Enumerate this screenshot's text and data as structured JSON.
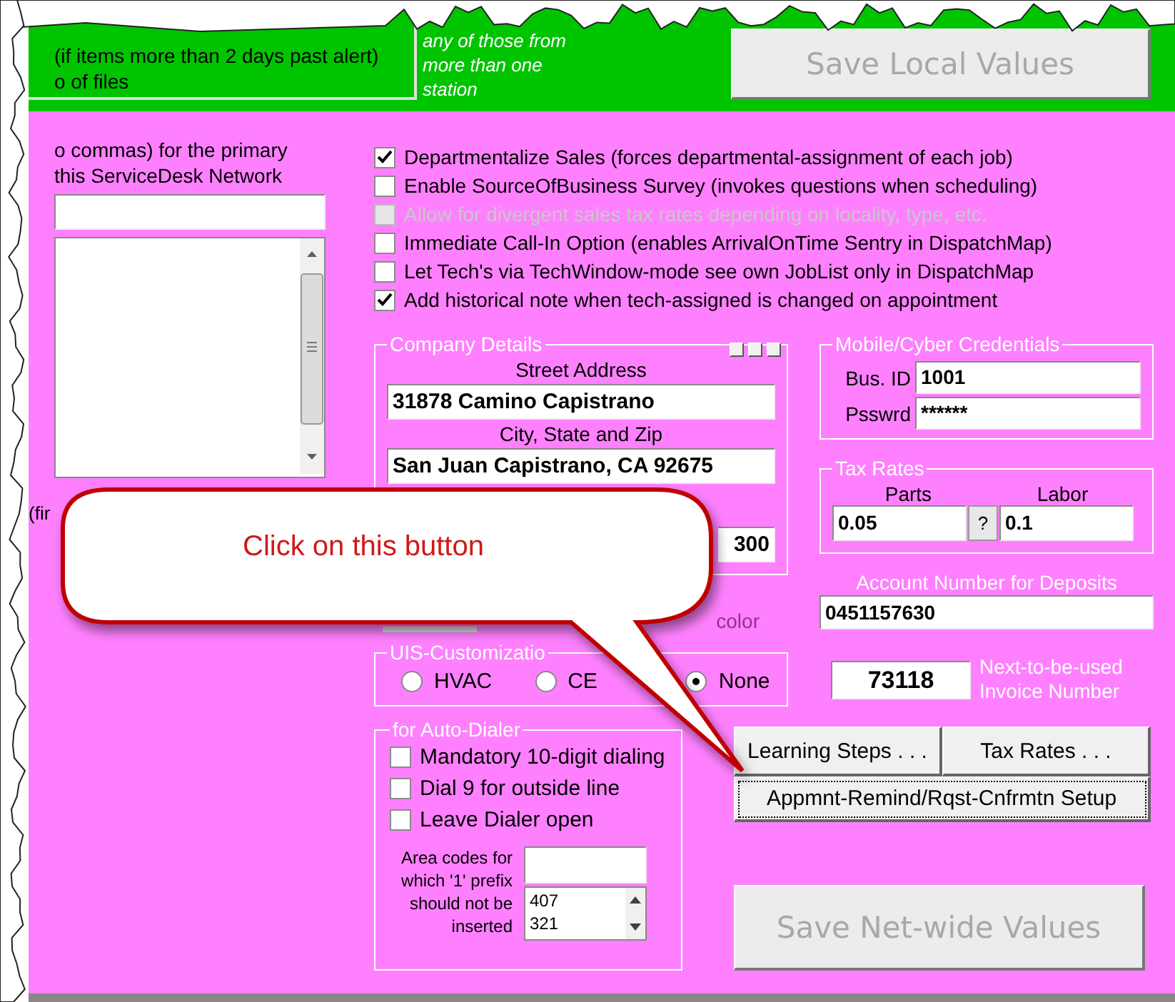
{
  "top_panel": {
    "notes": [
      "(if items more than 2 days past alert)",
      "o of files"
    ],
    "station_note": [
      "any of those from",
      "more than one",
      "station"
    ],
    "save_button": {
      "label": "Save Local Values",
      "disabled": true
    }
  },
  "network": {
    "label_lines": [
      "o commas) for the primary",
      "this ServiceDesk Network"
    ],
    "footer_text": "(fir"
  },
  "options": [
    {
      "label": "Departmentalize Sales (forces departmental-assignment of each job)",
      "checked": true,
      "disabled": false
    },
    {
      "label": "Enable SourceOfBusiness Survey (invokes questions when scheduling)",
      "checked": false,
      "disabled": false
    },
    {
      "label": "Allow for divergent sales tax rates depending on locality, type, etc.",
      "checked": false,
      "disabled": true
    },
    {
      "label": "Immediate Call-In Option (enables ArrivalOnTime Sentry in DispatchMap)",
      "checked": false,
      "disabled": false
    },
    {
      "label": "Let Tech's via TechWindow-mode see own JobList only in DispatchMap",
      "checked": false,
      "disabled": false
    },
    {
      "label": "Add historical note when tech-assigned is changed on appointment",
      "checked": true,
      "disabled": false
    }
  ],
  "company_details": {
    "title": "Company Details",
    "fields": [
      {
        "label": "Street Address",
        "value": "31878 Camino Capistrano"
      },
      {
        "label": "City, State and Zip",
        "value": "San Juan Capistrano, CA 92675"
      },
      {
        "value": "300"
      }
    ]
  },
  "color_label": "color",
  "uis_customization": {
    "title": "UIS-Customizatio",
    "options": [
      {
        "label": "HVAC",
        "selected": false
      },
      {
        "label": "CE",
        "selected": false
      },
      {
        "label": "None",
        "selected": true
      }
    ]
  },
  "auto_dialer": {
    "title": "for Auto-Dialer",
    "options": [
      {
        "label": "Mandatory 10-digit dialing",
        "checked": false
      },
      {
        "label": "Dial 9 for outside line",
        "checked": false
      },
      {
        "label": "Leave Dialer open",
        "checked": false
      }
    ],
    "area_codes_label": "Area codes for which '1' prefix should not be inserted",
    "area_codes": [
      "407",
      "321"
    ]
  },
  "credentials": {
    "title": "Mobile/Cyber Credentials",
    "fields": [
      {
        "label": "Bus. ID",
        "value": "1001"
      },
      {
        "label": "Psswrd",
        "value": "******"
      }
    ]
  },
  "tax_rates": {
    "title": "Tax Rates",
    "parts_label": "Parts",
    "parts": "0.05",
    "help_button": "?",
    "labor_label": "Labor",
    "labor": "0.1"
  },
  "deposit_account": {
    "label": "Account Number for Deposits",
    "value": "0451157630"
  },
  "invoice": {
    "value": "73118",
    "label_lines": [
      "Next-to-be-used",
      "Invoice Number"
    ]
  },
  "buttons": [
    {
      "label": "Learning Steps . . .",
      "focused": false
    },
    {
      "label": "Tax Rates . . .",
      "focused": false
    },
    {
      "label": "Appmnt-Remind/Rqst-Cnfrmtn Setup",
      "focused": true
    }
  ],
  "save_netwide_button": {
    "label": "Save Net-wide Values",
    "disabled": true
  },
  "callout": {
    "text": "Click on this button"
  }
}
